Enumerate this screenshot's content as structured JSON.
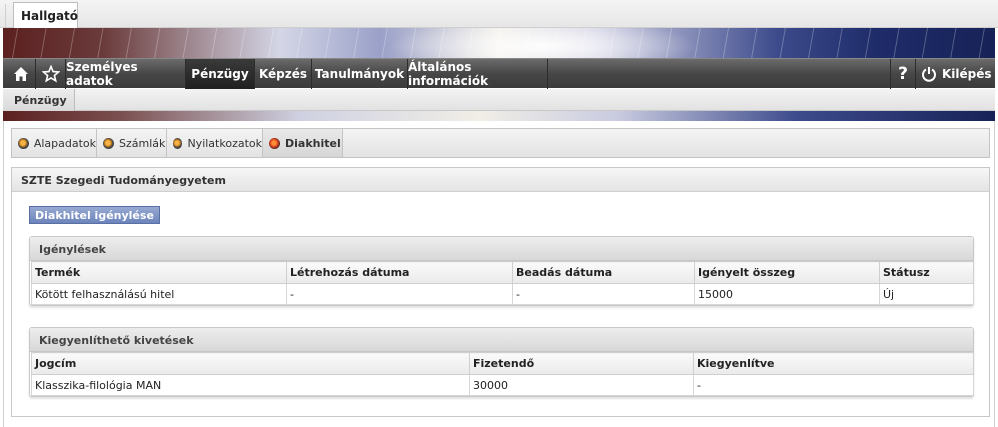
{
  "top": {
    "tab_label": "Hallgató"
  },
  "nav": {
    "items": [
      {
        "label": "Személyes adatok"
      },
      {
        "label": "Pénzügy"
      },
      {
        "label": "Képzés"
      },
      {
        "label": "Tanulmányok"
      },
      {
        "label": "Általános információk"
      }
    ],
    "help_label": "?",
    "logout_label": "Kilépés"
  },
  "subnav": {
    "active_label": "Pénzügy"
  },
  "inner_tabs": [
    {
      "label": "Alapadatok"
    },
    {
      "label": "Számlák"
    },
    {
      "label": "Nyilatkozatok"
    },
    {
      "label": "Diakhitel"
    }
  ],
  "panel": {
    "title": "SZTE Szegedi Tudományegyetem",
    "request_button": "Diakhitel igénylése"
  },
  "requests": {
    "caption": "Igénylések",
    "columns": [
      "Termék",
      "Létrehozás dátuma",
      "Beadás dátuma",
      "Igényelt összeg",
      "Státusz"
    ],
    "rows": [
      [
        "Kötött felhasználású hitel",
        "-",
        "-",
        "15000",
        "Új"
      ]
    ]
  },
  "payables": {
    "caption": "Kiegyenlíthető kivetések",
    "columns": [
      "Jogcím",
      "Fizetendő",
      "Kiegyenlítve"
    ],
    "rows": [
      [
        "Klasszika-filológia MAN",
        "30000",
        "-"
      ]
    ]
  },
  "colors": {
    "nav_dark": "#3b3b3b",
    "button_blue": "#6c84bb"
  }
}
